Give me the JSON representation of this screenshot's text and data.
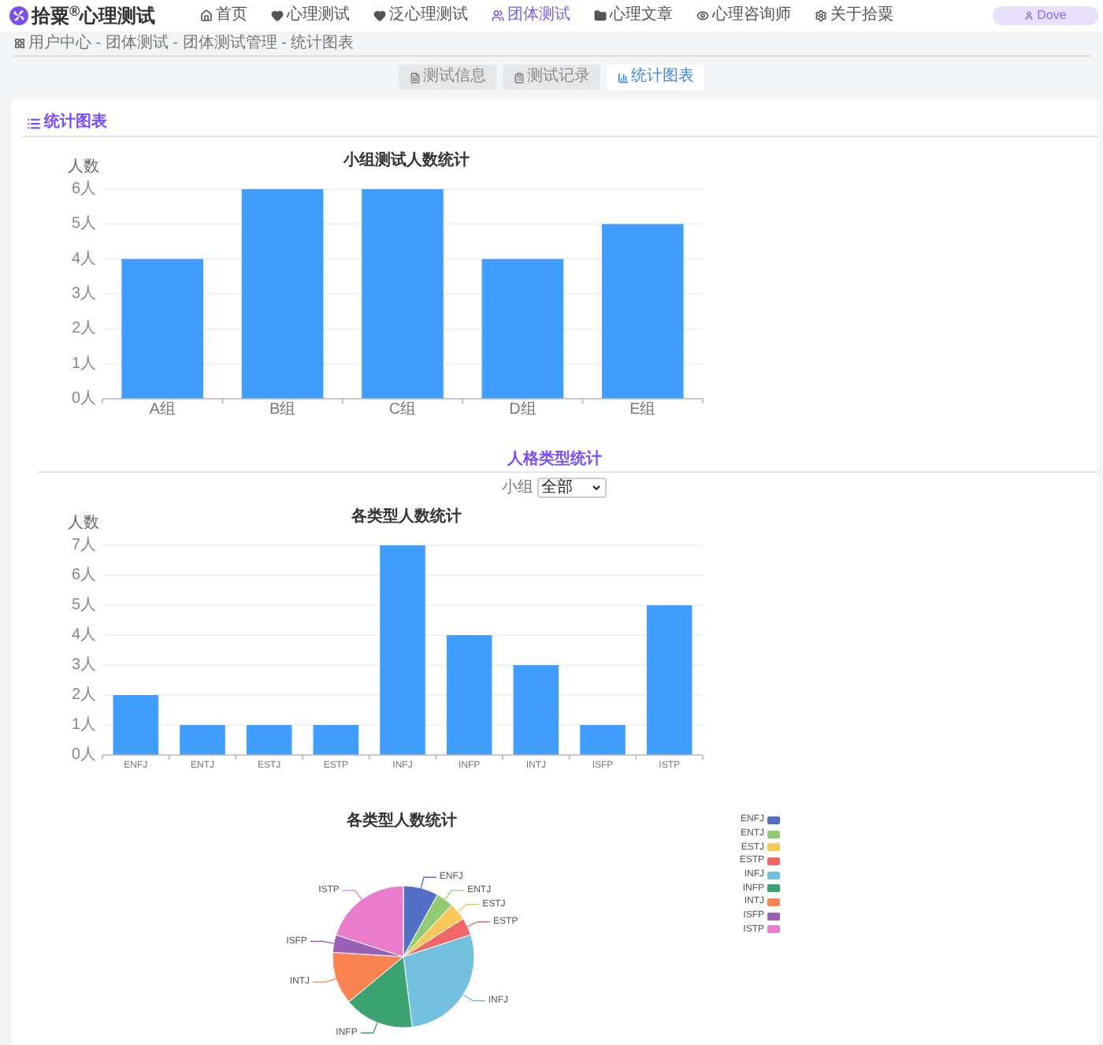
{
  "header": {
    "logo": "拾粟$^{®}$心理测试",
    "nav": [
      {
        "label": "首页",
        "selected": false
      },
      {
        "label": "心理测试",
        "selected": false
      },
      {
        "label": "泛心理测试",
        "selected": false
      },
      {
        "label": "团体测试",
        "selected": true
      },
      {
        "label": "心理文章",
        "selected": false
      },
      {
        "label": "心理咨询师",
        "selected": false
      },
      {
        "label": "关于拾粟",
        "selected": false
      }
    ],
    "user_button": "Dove"
  },
  "breadcrumb": "用户中心 - 团体测试 - 团体测试管理 - 统计图表",
  "tabs": [
    {
      "label": "测试信息",
      "selected": false
    },
    {
      "label": "测试记录",
      "selected": false
    },
    {
      "label": "统计图表",
      "selected": true
    }
  ],
  "panel": {
    "heading": "统计图表",
    "group_chart": {
      "chart_data": {
        "type": "bar",
        "title": "小组测试人数统计",
        "ylabel": "人数",
        "categories": [
          "A组",
          "B组",
          "C组",
          "D组",
          "E组"
        ],
        "values": [
          4,
          6,
          6,
          4,
          5
        ],
        "ylim": [
          0,
          6
        ],
        "yticks": [
          {
            "value": 0,
            "label": "0人"
          },
          {
            "value": 1,
            "label": "1人"
          },
          {
            "value": 2,
            "label": "2人"
          },
          {
            "value": 3,
            "label": "3人"
          },
          {
            "value": 4,
            "label": "4人"
          },
          {
            "value": 5,
            "label": "5人"
          },
          {
            "value": 6,
            "label": "6人"
          }
        ],
        "grid": true
      }
    },
    "personality_section": {
      "heading": "人格类型统计",
      "filter": {
        "label": "小组",
        "value": "全部"
      },
      "bar_chart": {
        "chart_data": {
          "type": "bar",
          "title": "各类型人数统计",
          "ylabel": "人数",
          "categories": [
            "ENFJ",
            "ENTJ",
            "ESTJ",
            "ESTP",
            "INFJ",
            "INFP",
            "INTJ",
            "ISFP",
            "ISTP"
          ],
          "values": [
            2,
            1,
            1,
            1,
            7,
            4,
            3,
            1,
            5
          ],
          "ylim": [
            0,
            7
          ],
          "yticks": [
            {
              "value": 0,
              "label": "0人"
            },
            {
              "value": 1,
              "label": "1人"
            },
            {
              "value": 2,
              "label": "2人"
            },
            {
              "value": 3,
              "label": "3人"
            },
            {
              "value": 4,
              "label": "4人"
            },
            {
              "value": 5,
              "label": "5人"
            },
            {
              "value": 6,
              "label": "6人"
            },
            {
              "value": 7,
              "label": "7人"
            }
          ],
          "grid": true
        }
      },
      "pie_chart": {
        "chart_data": {
          "type": "pie",
          "title": "各类型人数统计",
          "categories": [
            "ENFJ",
            "ENTJ",
            "ESTJ",
            "ESTP",
            "INFJ",
            "INFP",
            "INTJ",
            "ISFP",
            "ISTP"
          ],
          "values": [
            8,
            4,
            4,
            4,
            28,
            16,
            12,
            4,
            20
          ]
        },
        "legend": [
          {
            "label": "ENFJ",
            "color": "#5470c6"
          },
          {
            "label": "ENTJ",
            "color": "#91cc75"
          },
          {
            "label": "ESTJ",
            "color": "#fac858"
          },
          {
            "label": "ESTP",
            "color": "#ee6666"
          },
          {
            "label": "INFJ",
            "color": "#73c0de"
          },
          {
            "label": "INFP",
            "color": "#3ba272"
          },
          {
            "label": "INTJ",
            "color": "#fc8452"
          },
          {
            "label": "ISFP",
            "color": "#9a60b4"
          },
          {
            "label": "ISTP",
            "color": "#ea7ccc"
          }
        ]
      }
    }
  }
}
